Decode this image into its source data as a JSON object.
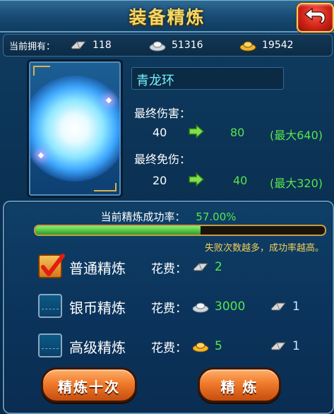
{
  "header": {
    "title": "装备精炼",
    "back_icon": "back-arrow-icon"
  },
  "resources": {
    "label": "当前拥有：",
    "items": [
      {
        "name": "refine-stone",
        "icon": "refine-stone-icon",
        "value": "118"
      },
      {
        "name": "silver",
        "icon": "silver-ingot-icon",
        "value": "51316"
      },
      {
        "name": "gold",
        "icon": "gold-ingot-icon",
        "value": "19542"
      }
    ]
  },
  "item": {
    "name": "青龙环",
    "icon": "qinglong-ring-icon"
  },
  "stats": {
    "damage": {
      "label": "最终伤害：",
      "current": "40",
      "next": "80",
      "max": "(最大640)"
    },
    "reduction": {
      "label": "最终免伤：",
      "current": "20",
      "next": "40",
      "max": "(最大320)"
    }
  },
  "refine": {
    "rate_label": "当前精炼成功率：",
    "rate": "57.00%",
    "rate_fraction": 0.57,
    "hint": "失败次数越多，成功率越高。"
  },
  "options": [
    {
      "title": "普通精炼",
      "checked": true,
      "cost_label": "花费：",
      "cost_a_icon": "refine-stone-icon",
      "cost_a": "2",
      "cost_b_icon": "",
      "cost_b": ""
    },
    {
      "title": "银币精炼",
      "checked": false,
      "cost_label": "花费：",
      "cost_a_icon": "silver-ingot-icon",
      "cost_a": "3000",
      "cost_b_icon": "refine-stone-icon",
      "cost_b": "1"
    },
    {
      "title": "高级精炼",
      "checked": false,
      "cost_label": "花费：",
      "cost_a_icon": "gold-ingot-icon",
      "cost_a": "5",
      "cost_b_icon": "refine-stone-icon",
      "cost_b": "1"
    }
  ],
  "buttons": {
    "refine_ten": "精炼十次",
    "refine": "精 炼"
  },
  "colors": {
    "accent_green": "#55e64f",
    "title_gold": "#f2d86a",
    "hint_yellow": "#f2cf57",
    "item_name": "#76f0ff"
  }
}
